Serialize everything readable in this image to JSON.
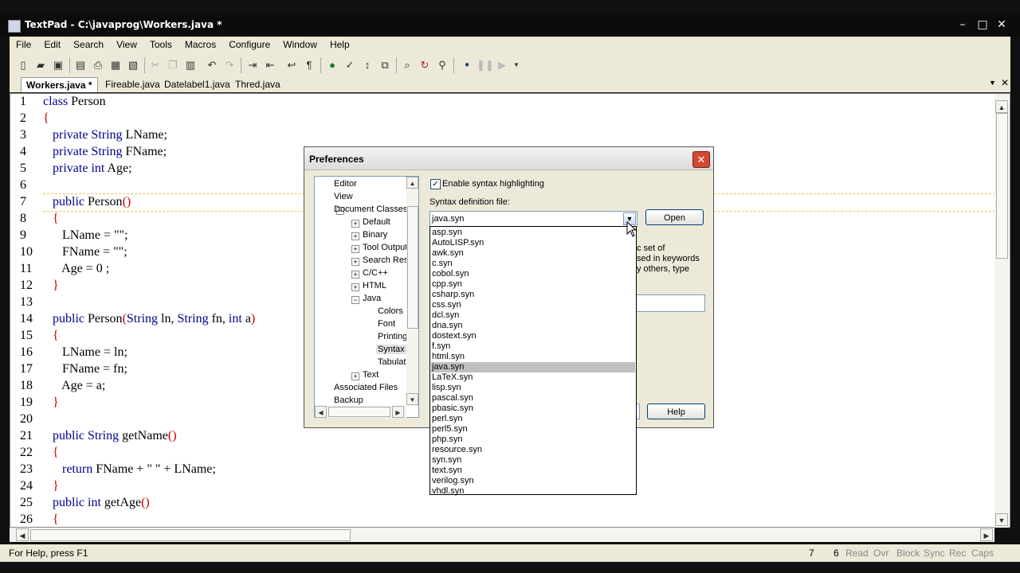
{
  "window": {
    "title": "TextPad - C:\\javaprog\\Workers.java *",
    "minimize": "–",
    "maximize": "□",
    "close": "✕"
  },
  "menu": [
    "File",
    "Edit",
    "Search",
    "View",
    "Tools",
    "Macros",
    "Configure",
    "Window",
    "Help"
  ],
  "tabs": [
    "Workers.java *",
    "Fireable.java",
    "Datelabel1.java",
    "Thred.java"
  ],
  "tab_controls": {
    "dropdown": "▼",
    "close": "✕"
  },
  "editor": {
    "lines": [
      {
        "n": "1",
        "segs": [
          {
            "t": "class",
            "c": "kw"
          },
          {
            "t": " Person",
            "c": ""
          }
        ]
      },
      {
        "n": "2",
        "segs": [
          {
            "t": "{",
            "c": "br"
          }
        ]
      },
      {
        "n": "3",
        "segs": [
          {
            "t": "   private String",
            "c": "kw"
          },
          {
            "t": " LName;",
            "c": ""
          }
        ]
      },
      {
        "n": "4",
        "segs": [
          {
            "t": "   private String",
            "c": "kw"
          },
          {
            "t": " FName;",
            "c": ""
          }
        ]
      },
      {
        "n": "5",
        "segs": [
          {
            "t": "   private int",
            "c": "kw"
          },
          {
            "t": " Age;",
            "c": ""
          }
        ]
      },
      {
        "n": "6",
        "segs": []
      },
      {
        "n": "7",
        "segs": [
          {
            "t": "   public",
            "c": "kw"
          },
          {
            "t": " Person",
            "c": ""
          },
          {
            "t": "()",
            "c": "br"
          }
        ]
      },
      {
        "n": "8",
        "segs": [
          {
            "t": "   {",
            "c": "br"
          }
        ]
      },
      {
        "n": "9",
        "segs": [
          {
            "t": "      LName = \"\";",
            "c": ""
          }
        ]
      },
      {
        "n": "10",
        "segs": [
          {
            "t": "      FName = \"\";",
            "c": ""
          }
        ]
      },
      {
        "n": "11",
        "segs": [
          {
            "t": "      Age = 0 ;",
            "c": ""
          }
        ]
      },
      {
        "n": "12",
        "segs": [
          {
            "t": "   }",
            "c": "br"
          }
        ]
      },
      {
        "n": "13",
        "segs": []
      },
      {
        "n": "14",
        "segs": [
          {
            "t": "   public",
            "c": "kw"
          },
          {
            "t": " Person",
            "c": ""
          },
          {
            "t": "(",
            "c": "br"
          },
          {
            "t": "String",
            "c": "kw"
          },
          {
            "t": " ln, ",
            "c": ""
          },
          {
            "t": "String",
            "c": "kw"
          },
          {
            "t": " fn, ",
            "c": ""
          },
          {
            "t": "int",
            "c": "kw"
          },
          {
            "t": " a",
            "c": ""
          },
          {
            "t": ")",
            "c": "br"
          }
        ]
      },
      {
        "n": "15",
        "segs": [
          {
            "t": "   {",
            "c": "br"
          }
        ]
      },
      {
        "n": "16",
        "segs": [
          {
            "t": "      LName = ln;",
            "c": ""
          }
        ]
      },
      {
        "n": "17",
        "segs": [
          {
            "t": "      FName = fn;",
            "c": ""
          }
        ]
      },
      {
        "n": "18",
        "segs": [
          {
            "t": "      Age = a;",
            "c": ""
          }
        ]
      },
      {
        "n": "19",
        "segs": [
          {
            "t": "   }",
            "c": "br"
          }
        ]
      },
      {
        "n": "20",
        "segs": []
      },
      {
        "n": "21",
        "segs": [
          {
            "t": "   public String",
            "c": "kw"
          },
          {
            "t": " getName",
            "c": ""
          },
          {
            "t": "()",
            "c": "br"
          }
        ]
      },
      {
        "n": "22",
        "segs": [
          {
            "t": "   {",
            "c": "br"
          }
        ]
      },
      {
        "n": "23",
        "segs": [
          {
            "t": "      return",
            "c": "kw"
          },
          {
            "t": " FName + \" \" + LName;",
            "c": ""
          }
        ]
      },
      {
        "n": "24",
        "segs": [
          {
            "t": "   }",
            "c": "br"
          }
        ]
      },
      {
        "n": "25",
        "segs": [
          {
            "t": "   public int",
            "c": "kw"
          },
          {
            "t": " getAge",
            "c": ""
          },
          {
            "t": "()",
            "c": "br"
          }
        ]
      },
      {
        "n": "26",
        "segs": [
          {
            "t": "   {",
            "c": "br"
          }
        ]
      }
    ]
  },
  "status": {
    "help": "For Help, press F1",
    "line": "7",
    "col": "6",
    "read": "Read",
    "ovr": "Ovr",
    "block": "Block",
    "sync": "Sync",
    "rec": "Rec",
    "caps": "Caps"
  },
  "dialog": {
    "title": "Preferences",
    "close": "✕",
    "tree": [
      {
        "label": "Editor",
        "indent": 0,
        "exp": ""
      },
      {
        "label": "View",
        "indent": 0,
        "exp": ""
      },
      {
        "label": "Document Classes",
        "indent": 0,
        "exp": "−"
      },
      {
        "label": "Default",
        "indent": 1,
        "exp": "+"
      },
      {
        "label": "Binary",
        "indent": 1,
        "exp": "+"
      },
      {
        "label": "Tool Output",
        "indent": 1,
        "exp": "+"
      },
      {
        "label": "Search Results",
        "indent": 1,
        "exp": "+"
      },
      {
        "label": "C/C++",
        "indent": 1,
        "exp": "+"
      },
      {
        "label": "HTML",
        "indent": 1,
        "exp": "+"
      },
      {
        "label": "Java",
        "indent": 1,
        "exp": "−"
      },
      {
        "label": "Colors",
        "indent": 2,
        "exp": ""
      },
      {
        "label": "Font",
        "indent": 2,
        "exp": ""
      },
      {
        "label": "Printing",
        "indent": 2,
        "exp": ""
      },
      {
        "label": "Syntax",
        "indent": 2,
        "exp": "",
        "selected": true
      },
      {
        "label": "Tabulation",
        "indent": 2,
        "exp": ""
      },
      {
        "label": "Text",
        "indent": 1,
        "exp": "+"
      },
      {
        "label": "Associated Files",
        "indent": 0,
        "exp": ""
      },
      {
        "label": "Backup",
        "indent": 0,
        "exp": ""
      }
    ],
    "enable_label": "Enable syntax highlighting",
    "enable_checked": "✓",
    "file_label": "Syntax definition file:",
    "file_value": "java.syn",
    "open_label": "Open",
    "help_label": "Help",
    "hidden_text": [
      "c set of",
      "sed in keywords",
      "y others, type"
    ],
    "files": [
      "asp.syn",
      "AutoLISP.syn",
      "awk.syn",
      "c.syn",
      "cobol.syn",
      "cpp.syn",
      "csharp.syn",
      "css.syn",
      "dcl.syn",
      "dna.syn",
      "dostext.syn",
      "f.syn",
      "html.syn",
      "java.syn",
      "LaTeX.syn",
      "lisp.syn",
      "pascal.syn",
      "pbasic.syn",
      "perl.syn",
      "perl5.syn",
      "php.syn",
      "resource.syn",
      "syn.syn",
      "text.syn",
      "verilog.syn",
      "vhdl.syn"
    ],
    "selected_file": "java.syn"
  }
}
